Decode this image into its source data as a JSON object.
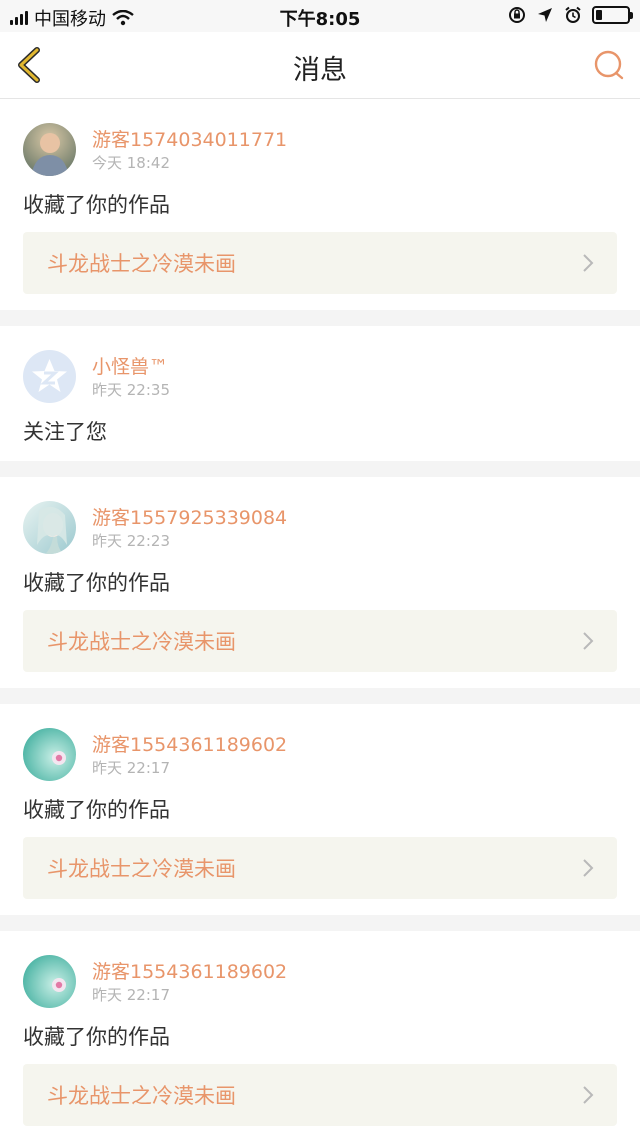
{
  "status_bar": {
    "carrier": "中国移动",
    "time": "下午8:05"
  },
  "nav": {
    "title": "消息",
    "back_icon": "chevron-left-icon",
    "search_icon": "search-icon"
  },
  "colors": {
    "accent": "#e8956a",
    "back_icon": "#e2b830",
    "work_box_bg": "#f5f5ee",
    "muted": "#b4b4b4"
  },
  "messages": [
    {
      "username": "游客1574034011771",
      "time": "今天 18:42",
      "action": "收藏了你的作品",
      "work_title": "斗龙战士之冷漠未画"
    },
    {
      "username": "小怪兽™",
      "time": "昨天 22:35",
      "action": "关注了您"
    },
    {
      "username": "游客1557925339084",
      "time": "昨天 22:23",
      "action": "收藏了你的作品",
      "work_title": "斗龙战士之冷漠未画"
    },
    {
      "username": "游客1554361189602",
      "time": "昨天 22:17",
      "action": "收藏了你的作品",
      "work_title": "斗龙战士之冷漠未画"
    },
    {
      "username": "游客1554361189602",
      "time": "昨天 22:17",
      "action": "收藏了你的作品",
      "work_title": "斗龙战士之冷漠未画"
    }
  ]
}
